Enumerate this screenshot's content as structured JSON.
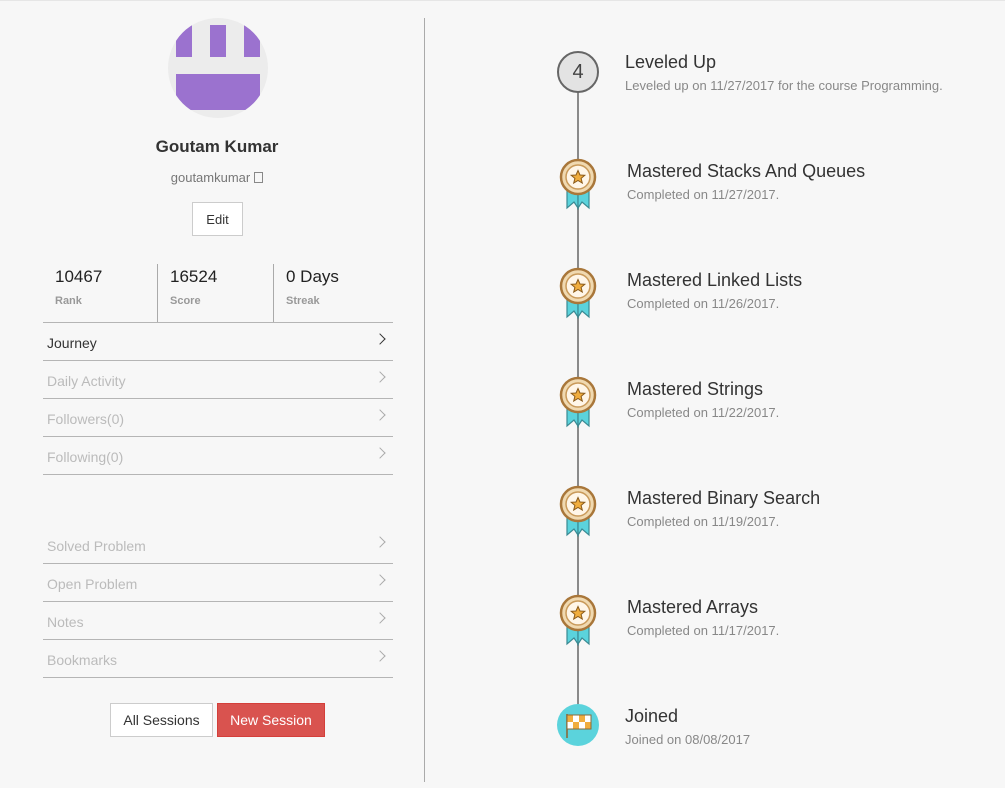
{
  "profile": {
    "name": "Goutam Kumar",
    "username": "goutamkumar",
    "edit_label": "Edit",
    "avatar_color": "#9b72cf"
  },
  "stats": [
    {
      "value": "10467",
      "label": "Rank"
    },
    {
      "value": "16524",
      "label": "Score"
    },
    {
      "value": "0 Days",
      "label": "Streak"
    }
  ],
  "menu_primary": [
    {
      "label": "Journey",
      "active": true
    },
    {
      "label": "Daily Activity",
      "active": false
    },
    {
      "label": "Followers(0)",
      "active": false
    },
    {
      "label": "Following(0)",
      "active": false
    }
  ],
  "menu_secondary": [
    {
      "label": "Solved Problem"
    },
    {
      "label": "Open Problem"
    },
    {
      "label": "Notes"
    },
    {
      "label": "Bookmarks"
    }
  ],
  "buttons": {
    "all_sessions": "All Sessions",
    "new_session": "New Session",
    "new_session_color": "#d9534f"
  },
  "timeline": {
    "level": {
      "number": "4",
      "title": "Leveled Up",
      "subtitle": "Leveled up on 11/27/2017 for the course Programming."
    },
    "achievements": [
      {
        "title": "Mastered Stacks And Queues",
        "subtitle": "Completed on 11/27/2017.",
        "icon": "medal-icon"
      },
      {
        "title": "Mastered Linked Lists",
        "subtitle": "Completed on 11/26/2017.",
        "icon": "medal-icon"
      },
      {
        "title": "Mastered Strings",
        "subtitle": "Completed on 11/22/2017.",
        "icon": "medal-icon"
      },
      {
        "title": "Mastered Binary Search",
        "subtitle": "Completed on 11/19/2017.",
        "icon": "medal-icon"
      },
      {
        "title": "Mastered Arrays",
        "subtitle": "Completed on 11/17/2017.",
        "icon": "medal-icon"
      }
    ],
    "joined": {
      "title": "Joined",
      "subtitle": "Joined on 08/08/2017",
      "icon": "checkered-flag-icon"
    }
  }
}
